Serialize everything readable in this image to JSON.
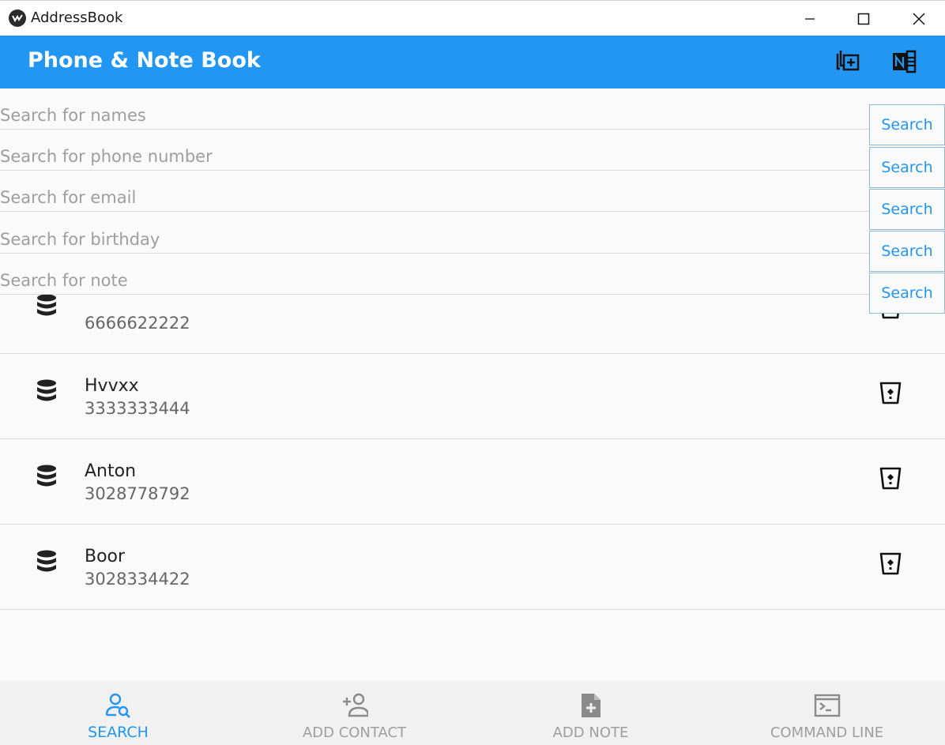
{
  "window": {
    "title": "AddressBook"
  },
  "appbar": {
    "title": "Phone & Note Book",
    "actions": [
      {
        "icon": "copy-plus-icon"
      },
      {
        "icon": "onenote-icon"
      }
    ]
  },
  "search": {
    "fields": [
      {
        "placeholder": "Search for names",
        "button": "Search"
      },
      {
        "placeholder": "Search for phone number",
        "button": "Search"
      },
      {
        "placeholder": "Search for email",
        "button": "Search"
      },
      {
        "placeholder": "Search for birthday",
        "button": "Search"
      },
      {
        "placeholder": "Search for note",
        "button": "Search"
      }
    ]
  },
  "contacts": [
    {
      "name": "",
      "phone": "6666622222"
    },
    {
      "name": "Hvvxx",
      "phone": "3333333444"
    },
    {
      "name": "Anton",
      "phone": "3028778792"
    },
    {
      "name": "Boor",
      "phone": "3028334422"
    }
  ],
  "bottom_nav": {
    "tabs": [
      {
        "label": "SEARCH",
        "icon": "person-search-icon",
        "active": true
      },
      {
        "label": "ADD CONTACT",
        "icon": "person-add-icon",
        "active": false
      },
      {
        "label": "ADD NOTE",
        "icon": "note-add-icon",
        "active": false
      },
      {
        "label": "COMMAND LINE",
        "icon": "console-icon",
        "active": false
      }
    ]
  },
  "colors": {
    "primary": "#2196f3",
    "background": "#fafafa",
    "inactive": "#9e9e9e"
  }
}
